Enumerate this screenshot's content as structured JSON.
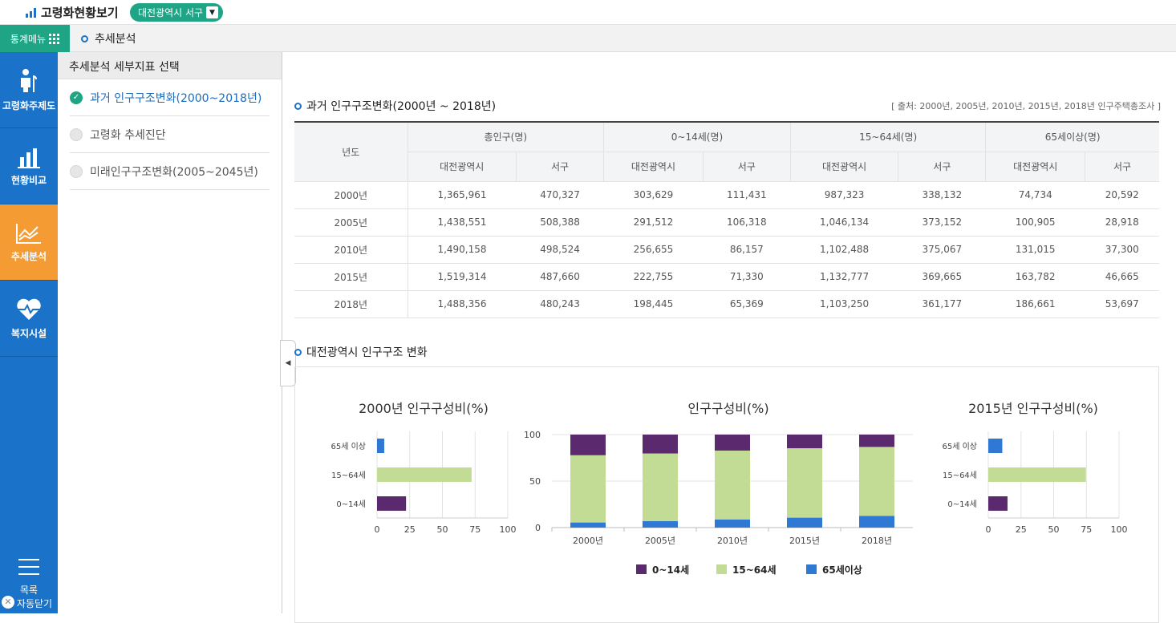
{
  "header": {
    "app_title": "고령화현황보기",
    "region": "대전광역시 서구"
  },
  "subbar": {
    "menu_label": "통계메뉴",
    "breadcrumb": "추세분석"
  },
  "sidebar": {
    "items": [
      {
        "label": "고령화주제도",
        "icon": "elderly-icon"
      },
      {
        "label": "현황비교",
        "icon": "bar-chart-icon"
      },
      {
        "label": "추세분석",
        "icon": "trend-chart-icon"
      },
      {
        "label": "복지시설",
        "icon": "heart-pulse-icon"
      }
    ],
    "footer_label": "목록",
    "auto_close_label": "자동닫기"
  },
  "subpanel": {
    "title": "추세분석 세부지표 선택",
    "items": [
      {
        "label": "과거 인구구조변화(2000~2018년)",
        "selected": true
      },
      {
        "label": "고령화 추세진단",
        "selected": false
      },
      {
        "label": "미래인구구조변화(2005~2045년)",
        "selected": false
      }
    ]
  },
  "table_section": {
    "title": "과거 인구구조변화(2000년 ~ 2018년)",
    "source": "[ 출처: 2000년, 2005년, 2010년, 2015년, 2018년 인구주택총조사 ]",
    "year_header": "년도",
    "groups": [
      "총인구(명)",
      "0~14세(명)",
      "15~64세(명)",
      "65세이상(명)"
    ],
    "subheaders": [
      "대전광역시",
      "서구"
    ],
    "rows": [
      {
        "year": "2000년",
        "values": [
          "1,365,961",
          "470,327",
          "303,629",
          "111,431",
          "987,323",
          "338,132",
          "74,734",
          "20,592"
        ]
      },
      {
        "year": "2005년",
        "values": [
          "1,438,551",
          "508,388",
          "291,512",
          "106,318",
          "1,046,134",
          "373,152",
          "100,905",
          "28,918"
        ]
      },
      {
        "year": "2010년",
        "values": [
          "1,490,158",
          "498,524",
          "256,655",
          "86,157",
          "1,102,488",
          "375,067",
          "131,015",
          "37,300"
        ]
      },
      {
        "year": "2015년",
        "values": [
          "1,519,314",
          "487,660",
          "222,755",
          "71,330",
          "1,132,777",
          "369,665",
          "163,782",
          "46,665"
        ]
      },
      {
        "year": "2018년",
        "values": [
          "1,488,356",
          "480,243",
          "198,445",
          "65,369",
          "1,103,250",
          "361,177",
          "186,661",
          "53,697"
        ]
      }
    ]
  },
  "chart_section": {
    "title": "대전광역시 인구구조 변화"
  },
  "colors": {
    "age_0_14": "#5b2a6e",
    "age_15_64": "#c2dc96",
    "age_65_plus": "#2f78d4",
    "accent": "#1a73c8",
    "green": "#20a486",
    "orange": "#f59b33"
  },
  "chart_data": [
    {
      "type": "bar",
      "orientation": "horizontal",
      "title": "2000년 인구구성비(%)",
      "categories": [
        "65세 이상",
        "15~64세",
        "0~14세"
      ],
      "values": [
        5.5,
        72.3,
        22.2
      ],
      "xlim": [
        0,
        100
      ],
      "xticks": [
        0,
        25,
        50,
        75,
        100
      ]
    },
    {
      "type": "bar",
      "stacked": true,
      "title": "인구구성비(%)",
      "categories": [
        "2000년",
        "2005년",
        "2010년",
        "2015년",
        "2018년"
      ],
      "series": [
        {
          "name": "0~14세",
          "values": [
            22.2,
            20.3,
            17.2,
            14.7,
            13.3
          ]
        },
        {
          "name": "15~64세",
          "values": [
            72.3,
            72.7,
            74.0,
            74.6,
            74.1
          ]
        },
        {
          "name": "65세이상",
          "values": [
            5.5,
            7.0,
            8.8,
            10.7,
            12.6
          ]
        }
      ],
      "ylim": [
        0,
        100
      ],
      "yticks": [
        0,
        50,
        100
      ],
      "legend": "bottom"
    },
    {
      "type": "bar",
      "orientation": "horizontal",
      "title": "2015년 인구구성비(%)",
      "categories": [
        "65세 이상",
        "15~64세",
        "0~14세"
      ],
      "values": [
        10.7,
        74.6,
        14.7
      ],
      "xlim": [
        0,
        100
      ],
      "xticks": [
        0,
        25,
        50,
        75,
        100
      ]
    }
  ]
}
